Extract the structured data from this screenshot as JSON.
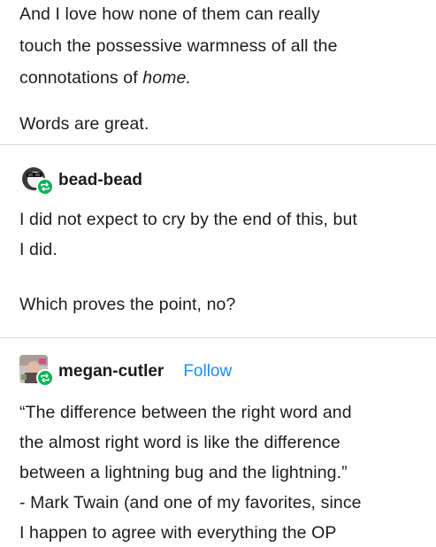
{
  "post1": {
    "paragraphs": [
      [
        "And I love how none of them can really",
        "touch the possessive warmness of all the"
      ],
      [
        "Words are great."
      ]
    ],
    "line3_prefix": "connotations of ",
    "line3_em": "home."
  },
  "post2": {
    "username": "bead-bead",
    "lines": [
      "I did not expect to cry by the end of this, but",
      "I did."
    ],
    "lines2": [
      "Which proves the point, no?"
    ]
  },
  "post3": {
    "username": "megan-cutler",
    "follow_label": "Follow",
    "lines": [
      "“The difference between the right word and",
      "the almost right word is like the difference",
      "between a lightning bug and the lightning.”",
      "- Mark Twain (and one of my favorites, since",
      "I happen to agree with everything the OP"
    ]
  },
  "colors": {
    "accent": "#1a8cff",
    "reblog_green": "#00b352",
    "divider": "#d6d6d6"
  },
  "icons": {
    "reblog": "reblog-icon",
    "avatar1": "sunglasses-avatar",
    "avatar2": "photo-avatar"
  }
}
